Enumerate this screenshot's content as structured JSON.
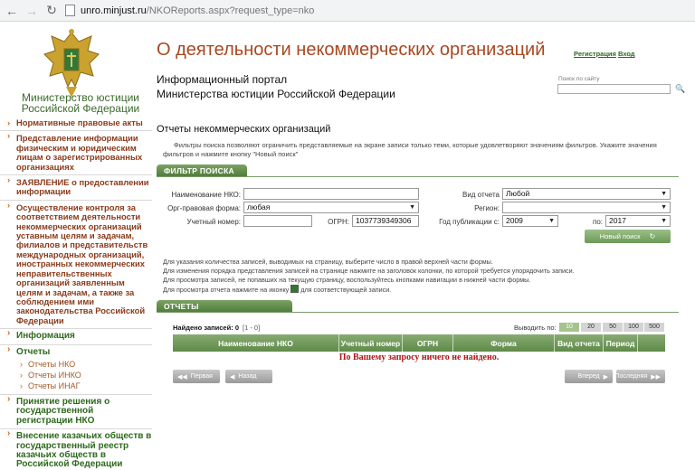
{
  "browser": {
    "url_host": "unro.minjust.ru",
    "url_path": "/NKOReports.aspx?request_type=nko"
  },
  "header": {
    "site_title": "О деятельности некоммерческих организаций",
    "portal_line1": "Информационный портал",
    "portal_line2": "Министерства юстиции Российской Федерации",
    "login_label": "Регистрация",
    "signin_label": "Вход",
    "search_label": "Поиск по сайту",
    "search_value": ""
  },
  "sidebar": {
    "ministry_line1": "Министерство юстиции",
    "ministry_line2": "Российской Федерации",
    "items": [
      {
        "label": "Нормативные правовые акты"
      },
      {
        "label": "Представление информации физическим и юридическим лицам о зарегистрированных организациях"
      },
      {
        "label": "ЗАЯВЛЕНИЕ о предоставлении информации"
      },
      {
        "label": "Осуществление контроля за соответствием деятельности некоммерческих организаций уставным целям и задачам, филиалов и представительств международных организаций, иностранных некоммерческих неправительственных организаций заявленным целям и задачам, а также за соблюдением ими законодательства Российской Федерации"
      }
    ],
    "info_label": "Информация",
    "reports_label": "Отчеты",
    "reports_sub": [
      "Отчеты НКО",
      "Отчеты ИНКО",
      "Отчеты ИНАГ"
    ],
    "decision_label": "Принятие решения о государственной регистрации НКО",
    "cossack_label": "Внесение казачьих обществ в государственный реестр казачьих обществ в Российской Федерации"
  },
  "main": {
    "heading": "Отчеты некоммерческих организаций",
    "description": "Фильтры поиска позволяют ограничить представляемые на экране записи только теми, которые удовлетворяют значениям фильтров. Укажите значения фильтров и нажмите кнопку \"Новый поиск\"",
    "filter_tab": "ФИЛЬТР ПОИСКА",
    "reports_tab": "ОТЧЕТЫ"
  },
  "filter": {
    "name_label": "Наименование НКО:",
    "name_value": "",
    "legal_form_label": "Орг-правовая форма:",
    "legal_form_value": "любая",
    "account_label": "Учетный номер:",
    "account_value": "",
    "ogrn_label": "ОГРН:",
    "ogrn_value": "1037739349306",
    "report_type_label": "Вид отчета",
    "report_type_value": "Любой",
    "region_label": "Регион:",
    "region_value": "",
    "pub_from_label": "Год публикации с:",
    "pub_from_value": "2009",
    "pub_to_label": "по:",
    "pub_to_value": "2017",
    "new_search_label": "Новый поиск"
  },
  "notes": [
    "Для указания количества записей, выводимых на страницу, выберите число в правой верхней части формы.",
    "Для изменения порядка представления записей на странице нажмите на заголовок колонки, по которой требуется упорядочить записи.",
    "Для просмотра записей, не попавших на текущую страницу, воспользуйтесь кнопками навигации в нижней части формы.",
    "Для просмотра отчета нажмите на иконку",
    "для соответствующей записи."
  ],
  "results": {
    "found_label": "Найдено записей:",
    "found_count": "0",
    "range": "[1 - 0]",
    "per_page_label": "Выводить по:",
    "per_page_options": [
      "10",
      "20",
      "50",
      "100",
      "500"
    ],
    "columns": [
      "Наименование НКО",
      "Учетный номер",
      "ОГРН",
      "Форма",
      "Вид отчета",
      "Период"
    ],
    "empty_message": "По Вашему запросу ничего не найдено."
  },
  "pager": {
    "first": "Первая",
    "prev": "Назад",
    "next": "Вперед",
    "last": "Последняя"
  },
  "colors": {
    "accent_green": "#5e8b49",
    "title_brown": "#a84820",
    "error_red": "#b01515"
  }
}
